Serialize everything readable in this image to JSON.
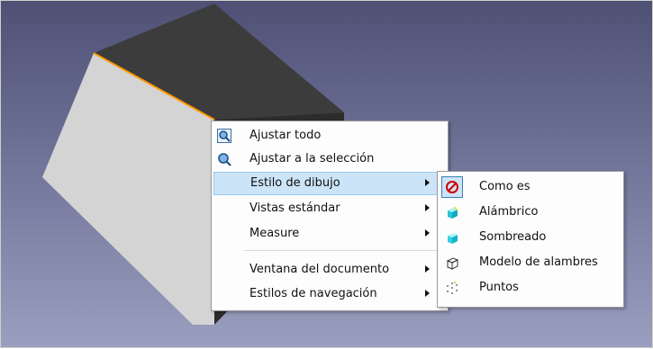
{
  "context_menu": {
    "items": [
      {
        "label": "Ajustar todo",
        "icon": "fit-all-icon",
        "submenu": false
      },
      {
        "label": "Ajustar a la selección",
        "icon": "fit-selection-icon",
        "submenu": false
      },
      {
        "label": "Estilo de dibujo",
        "icon": "",
        "submenu": true,
        "highlighted": true
      },
      {
        "label": "Vistas estándar",
        "icon": "",
        "submenu": true
      },
      {
        "label": "Measure",
        "icon": "",
        "submenu": true
      },
      {
        "label": "Ventana del documento",
        "icon": "",
        "submenu": true
      },
      {
        "label": "Estilos de navegación",
        "icon": "",
        "submenu": true
      }
    ]
  },
  "submenu": {
    "items": [
      {
        "label": "Como es",
        "icon": "as-is-icon",
        "checked": true
      },
      {
        "label": "Alámbrico",
        "icon": "flat-lines-icon"
      },
      {
        "label": "Sombreado",
        "icon": "shaded-icon"
      },
      {
        "label": "Modelo de alambres",
        "icon": "wireframe-icon"
      },
      {
        "label": "Puntos",
        "icon": "points-icon"
      }
    ]
  },
  "colors": {
    "background_top": "#4e5074",
    "background_bottom": "#9a9fbf",
    "highlight": "#cce4f7",
    "selected_edge": "#ff9900"
  }
}
